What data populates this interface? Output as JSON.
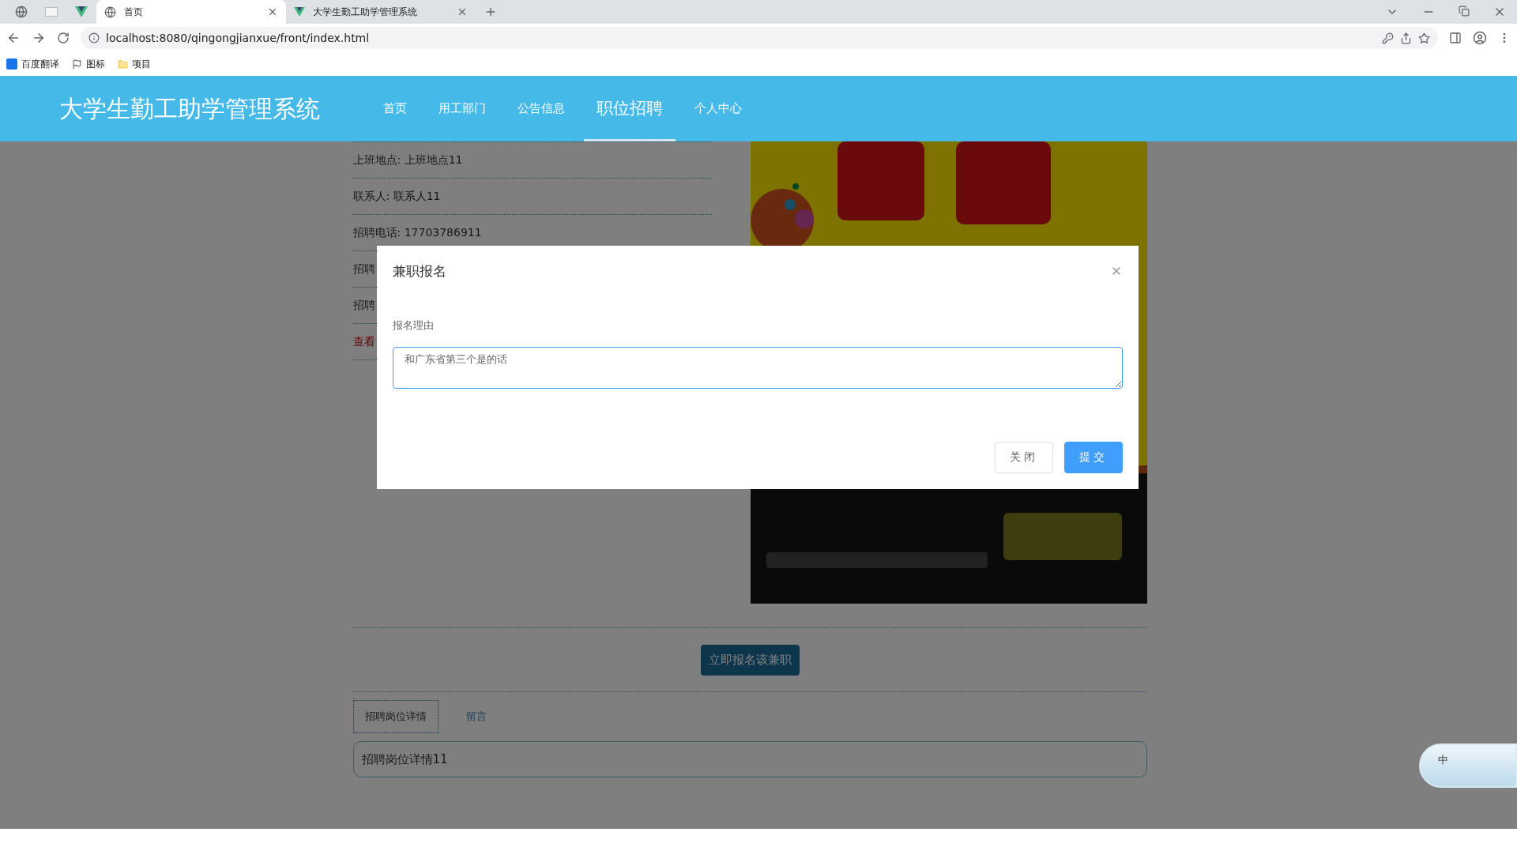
{
  "browser": {
    "tabs": [
      {
        "title": "首页",
        "selected": true
      },
      {
        "title": "大学生勤工助学管理系统",
        "selected": false
      }
    ],
    "url": "localhost:8080/qingongjianxue/front/index.html",
    "bookmarks": [
      "百度翻译",
      "图标",
      "项目"
    ]
  },
  "header": {
    "title": "大学生勤工助学管理系统",
    "nav": [
      {
        "label": "首页",
        "selected": false
      },
      {
        "label": "用工部门",
        "selected": false
      },
      {
        "label": "公告信息",
        "selected": false
      },
      {
        "label": "职位招聘",
        "selected": true
      },
      {
        "label": "个人中心",
        "selected": false
      }
    ]
  },
  "details": [
    {
      "text": "上班地点: 上班地点11",
      "kind": "field"
    },
    {
      "text": "联系人: 联系人11",
      "kind": "field"
    },
    {
      "text": "招聘电话: 17703786911",
      "kind": "field"
    },
    {
      "text": "招聘",
      "kind": "field"
    },
    {
      "text": "招聘",
      "kind": "field"
    },
    {
      "text": "查看",
      "kind": "link"
    }
  ],
  "apply_button": "立即报名该兼职",
  "detail_tabs": [
    {
      "label": "招聘岗位详情",
      "selected": true
    },
    {
      "label": "留言",
      "selected": false
    }
  ],
  "detail_content": "招聘岗位详情11",
  "modal": {
    "title": "兼职报名",
    "field_label": "报名理由",
    "value": "和广东省第三个是的话",
    "buttons": [
      {
        "label": "关闭",
        "kind": "default"
      },
      {
        "label": "提交",
        "kind": "primary"
      }
    ]
  },
  "ime": {
    "label": "中"
  }
}
